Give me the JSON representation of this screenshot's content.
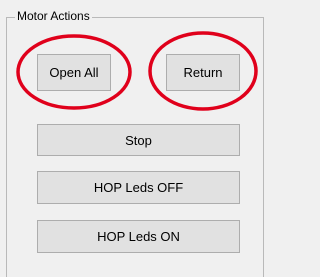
{
  "group": {
    "title": "Motor Actions"
  },
  "buttons": {
    "open_all": "Open All",
    "return": "Return",
    "stop": "Stop",
    "hop_leds_off": "HOP Leds OFF",
    "hop_leds_on": "HOP Leds ON"
  },
  "annotation": {
    "highlight_color": "#e0001b"
  }
}
